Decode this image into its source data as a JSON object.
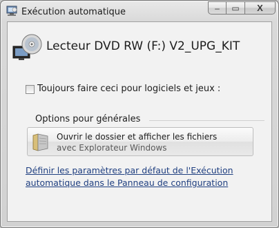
{
  "window": {
    "title": "Exécution automatique",
    "icon": "autoplay-icon"
  },
  "caption_buttons": {
    "minimize": "–",
    "maximize": "▭",
    "close": "X"
  },
  "drive": {
    "icon": "dvd-drive-icon",
    "label": "Lecteur DVD RW (F:) V2_UPG_KIT"
  },
  "always_option": {
    "checked": false,
    "label": "Toujours faire ceci pour logiciels et jeux :"
  },
  "general_options": {
    "heading": "Options pour générales",
    "items": [
      {
        "icon": "folder-icon",
        "title": "Ouvrir le dossier et afficher les fichiers",
        "subtitle": "avec Explorateur Windows"
      }
    ]
  },
  "settings_link": {
    "line1": "Définir les paramètres par défaut de l'Exécution",
    "line2": "automatique dans le Panneau de configuration"
  }
}
